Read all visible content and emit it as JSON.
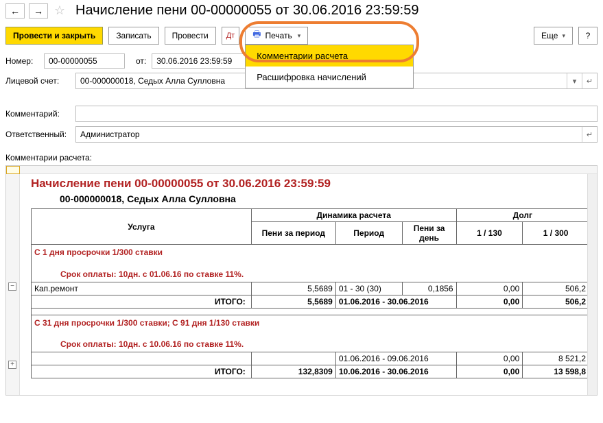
{
  "header": {
    "title": "Начисление пени 00-00000055 от 30.06.2016 23:59:59"
  },
  "toolbar": {
    "post_close": "Провести и закрыть",
    "save": "Записать",
    "post": "Провести",
    "print": "Печать",
    "more": "Еще",
    "help": "?"
  },
  "print_menu": {
    "item1": "Комментарии расчета",
    "item2": "Расшифровка начислений"
  },
  "form": {
    "number_label": "Номер:",
    "number": "00-00000055",
    "from_label": "от:",
    "date": "30.06.2016 23:59:59",
    "account_label": "Лицевой счет:",
    "account": "00-000000018, Седых Алла Сулловна",
    "comment_label": "Комментарий:",
    "comment": "",
    "responsible_label": "Ответственный:",
    "responsible": "Администратор",
    "calc_comments_label": "Комментарии расчета:"
  },
  "report": {
    "title": "Начисление пени 00-00000055 от 30.06.2016 23:59:59",
    "subtitle": "00-000000018, Седых Алла Сулловна",
    "headers": {
      "service": "Услуга",
      "dynamics": "Динамика расчета",
      "debt": "Долг",
      "peni_period": "Пени за период",
      "period": "Период",
      "peni_day": "Пени за день",
      "r130": "1 / 130",
      "r300": "1 / 300"
    },
    "group1": {
      "title": "С 1 дня просрочки 1/300 ставки",
      "rate": "Срок оплаты: 10дн. с 01.06.16 по ставке 11%.",
      "rows": [
        {
          "name": "Кап.ремонт",
          "peni_period": "5,5689",
          "period": "01 - 30 (30)",
          "peni_day": "0,1856",
          "r130": "0,00",
          "r300": "506,2"
        }
      ],
      "total": {
        "name": "ИТОГО:",
        "peni_period": "5,5689",
        "period": "01.06.2016 - 30.06.2016",
        "peni_day": "",
        "r130": "0,00",
        "r300": "506,2"
      }
    },
    "group2": {
      "title": "С 31 дня просрочки 1/300 ставки; С 91 дня 1/130 ставки",
      "rate": "Срок оплаты: 10дн. с 10.06.16 по ставке 11%.",
      "rows": [
        {
          "name": "",
          "peni_period": "",
          "period": "01.06.2016 - 09.06.2016",
          "peni_day": "",
          "r130": "0,00",
          "r300": "8 521,2"
        }
      ],
      "total": {
        "name": "ИТОГО:",
        "peni_period": "132,8309",
        "period": "10.06.2016 - 30.06.2016",
        "peni_day": "",
        "r130": "0,00",
        "r300": "13 598,8"
      }
    }
  }
}
